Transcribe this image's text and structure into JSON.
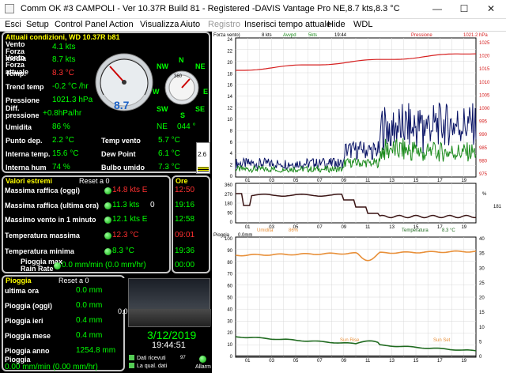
{
  "window": {
    "title": "Comm OK  #3 CAMPOLI - Ver 10.37R Build 81 - Registered  -DAVIS Vantage Pro  NE,8.7 kts,8.3 °C",
    "minimize": "—",
    "maximize": "☐",
    "close": "✕"
  },
  "menu": [
    "Esci",
    "Setup",
    "Control Panel",
    "Action",
    "Visualizza",
    "Aiuto",
    "Registro",
    "Inserisci tempo attuale",
    "Hide",
    "WDL"
  ],
  "current": {
    "header": "Attuali condizioni, WD 10.37R b81",
    "rows": [
      {
        "label": "Vento Forza media",
        "value": "4.1 kts"
      },
      {
        "label": "Vento Forza attuale",
        "value": "8.7 kts"
      },
      {
        "label": "Temp.",
        "value": "8.3 °C"
      },
      {
        "label": "Trend temp",
        "value": "-0.2 °C /hr"
      },
      {
        "label": "Pressione",
        "value": "1021.3 hPa"
      },
      {
        "label": "Diff. pressione",
        "value": "+0.8hPa/hr"
      },
      {
        "label": "Umidita",
        "value": "86 %"
      },
      {
        "label": "Punto dep.",
        "value": "2.2 °C"
      },
      {
        "label": "Interna temp.",
        "value": "15.6 °C"
      },
      {
        "label": "Interna hum",
        "value": "74 %"
      }
    ],
    "gauge": {
      "speed": "8.7",
      "compass": [
        "N",
        "NE",
        "E",
        "SE",
        "S",
        "SW",
        "W",
        "NW"
      ],
      "direction": "NE",
      "degrees": "044 °",
      "dial_max": "360"
    },
    "right_rows": [
      {
        "label": "Temp vento",
        "value": "5.7 °C"
      },
      {
        "label": "Dew Point",
        "value": "6.1 °C"
      },
      {
        "label": "Bulbo umido",
        "value": "7.3 °C"
      }
    ],
    "uv": "2.6"
  },
  "extremes": {
    "header": "Valori estremi",
    "reset": "Reset a 0",
    "time_header": "Ore",
    "rows": [
      {
        "label": "Massima raffica (oggi)",
        "value": "14.8 kts E",
        "time": "12:50"
      },
      {
        "label": "Massima raffica (ultima ora)",
        "value": "11.3 kts",
        "extra": "0",
        "time": "19:16"
      },
      {
        "label": "Massimo vento in 1 minuto",
        "value": "12.1 kts E",
        "time": "12:58"
      },
      {
        "label": "Temperatura massima",
        "value": "12.3 °C",
        "time": "09:01"
      },
      {
        "label": "Temperatura minima",
        "value": "8.3 °C",
        "time": "19:36"
      },
      {
        "label": "Pioggia max Rain Rate",
        "value": "0.0 mm/min (0.0 mm/hr)",
        "time": "00:00"
      }
    ]
  },
  "rain": {
    "header": "Pioggia",
    "reset": "Reset a 0",
    "rows": [
      {
        "label": "ultima ora",
        "value": "0.0 mm"
      },
      {
        "label": "Pioggia (oggi)",
        "value": "0.0 mm"
      },
      {
        "label": "Pioggia ieri",
        "value": "0.4 mm"
      },
      {
        "label": "Pioggia mese",
        "value": "0.4 mm"
      },
      {
        "label": "Pioggia anno",
        "value": "1254.8 mm"
      }
    ],
    "rate_label": "Pioggia",
    "rate_value": "0.00 mm/min (0.00 mm/hr)"
  },
  "camera": {
    "zoom": "0.0",
    "date": "3/12/2019",
    "time": "19:44:51",
    "dati_ricevuti": "Dati ricevuti",
    "count": "97",
    "qual_dati": "La qual. dati",
    "allarm": "Allarm"
  },
  "charts": {
    "top": {
      "labels": [
        "Forza vento)",
        "8 kts",
        "Avvpd",
        "5kts",
        "19:44",
        "Pressione",
        "1021.2 hPa"
      ],
      "left_ticks": [
        "24",
        "22",
        "20",
        "18",
        "16",
        "14",
        "12",
        "10",
        "8",
        "6",
        "4",
        "2",
        "0"
      ],
      "right_ticks": [
        "1025",
        "1020",
        "1015",
        "1010",
        "1005",
        "1000",
        "995",
        "990",
        "985",
        "980",
        "975"
      ],
      "x_ticks": [
        "01",
        "03",
        "05",
        "07",
        "09",
        "11",
        "13",
        "15",
        "17",
        "19"
      ]
    },
    "mid": {
      "left_ticks": [
        "360",
        "270",
        "180",
        "90",
        "0"
      ],
      "right_label": "181",
      "right_unit": "%",
      "x_ticks": [
        "01",
        "03",
        "05",
        "07",
        "09",
        "11",
        "13",
        "15",
        "17",
        "19"
      ]
    },
    "bottom": {
      "labels": [
        "Umidita",
        "86%",
        "Temperatura",
        "8.3 °C",
        "Pioggia",
        "0.0mm"
      ],
      "left_ticks": [
        "100",
        "90",
        "80",
        "70",
        "60",
        "50",
        "40",
        "30",
        "20",
        "10",
        "0"
      ],
      "right_ticks": [
        "40",
        "35",
        "30",
        "25",
        "20",
        "15",
        "10",
        "5",
        "0"
      ],
      "sun_rise": "Sun Rise",
      "sun_set": "Sun Set",
      "x_ticks": [
        "01",
        "03",
        "05",
        "07",
        "09",
        "11",
        "13",
        "15",
        "17",
        "19"
      ],
      "x_extra": "Sun Set"
    }
  }
}
